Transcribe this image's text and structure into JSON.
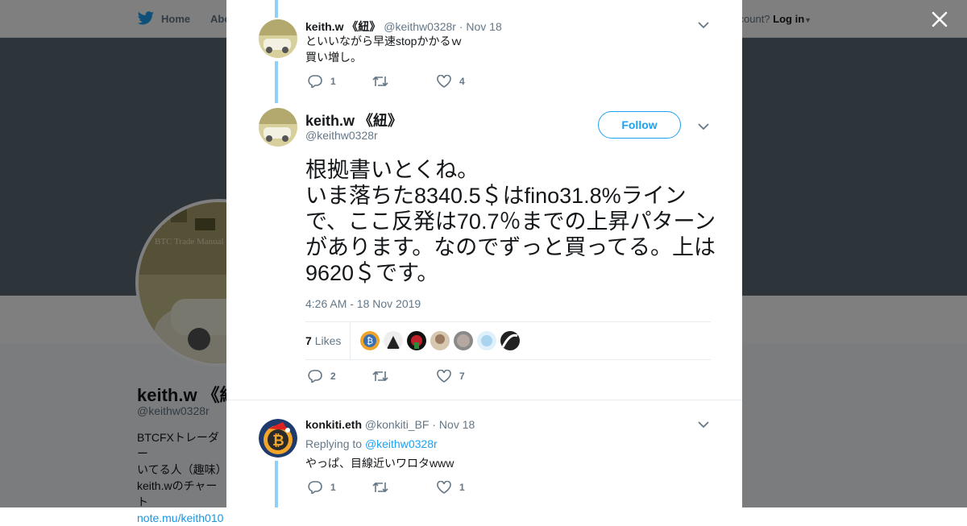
{
  "nav": {
    "home": "Home",
    "about": "Abo",
    "login_prompt": "ccount?",
    "login": "Log in"
  },
  "profile": {
    "name": "keith.w 《紐",
    "handle": "@keithw0328r",
    "bio_lines": [
      "BTCFXトレーダー",
      "いてる人（趣味）",
      "keith.wのチャート"
    ],
    "bio_link": "note.mu/keith010",
    "avatar_caption": "BTC Trade Manual"
  },
  "tweets": {
    "prev": {
      "name": "keith.w 《紐》",
      "handle": "@keithw0328r",
      "date": "· Nov 18",
      "line1": "といいながら早速stopかかるｗ",
      "line2": "買い増し。",
      "replies": "1",
      "retweets": "",
      "likes": "4"
    },
    "main": {
      "name": "keith.w 《紐》",
      "handle": "@keithw0328r",
      "follow": "Follow",
      "text": "根拠書いとくね。\nいま落ちた8340.5＄はfino31.8%ラインで、ここ反発は70.7％までの上昇パターンがあります。なのでずっと買ってる。上は9620＄です。",
      "time": "4:26 AM - 18 Nov 2019",
      "likes_count": "7",
      "likes_label": "Likes",
      "replies": "2",
      "retweets": "",
      "likes": "7"
    },
    "reply": {
      "name": "konkiti.eth",
      "handle": "@konkiti_BF",
      "date": "· Nov 18",
      "replying_to": "Replying to",
      "replying_handle": "@keithw0328r",
      "text": "やっぱ、目線近いワロタwww",
      "replies": "1",
      "retweets": "",
      "likes": "1"
    }
  },
  "icons": {
    "reply": "reply-icon",
    "retweet": "retweet-icon",
    "like": "heart-icon",
    "caret": "chevron-down-icon",
    "close": "close-icon",
    "twitter": "twitter-bird-icon"
  },
  "colors": {
    "accent": "#1da1f2",
    "thread_line": "#8ed0f9",
    "muted": "#657786"
  }
}
